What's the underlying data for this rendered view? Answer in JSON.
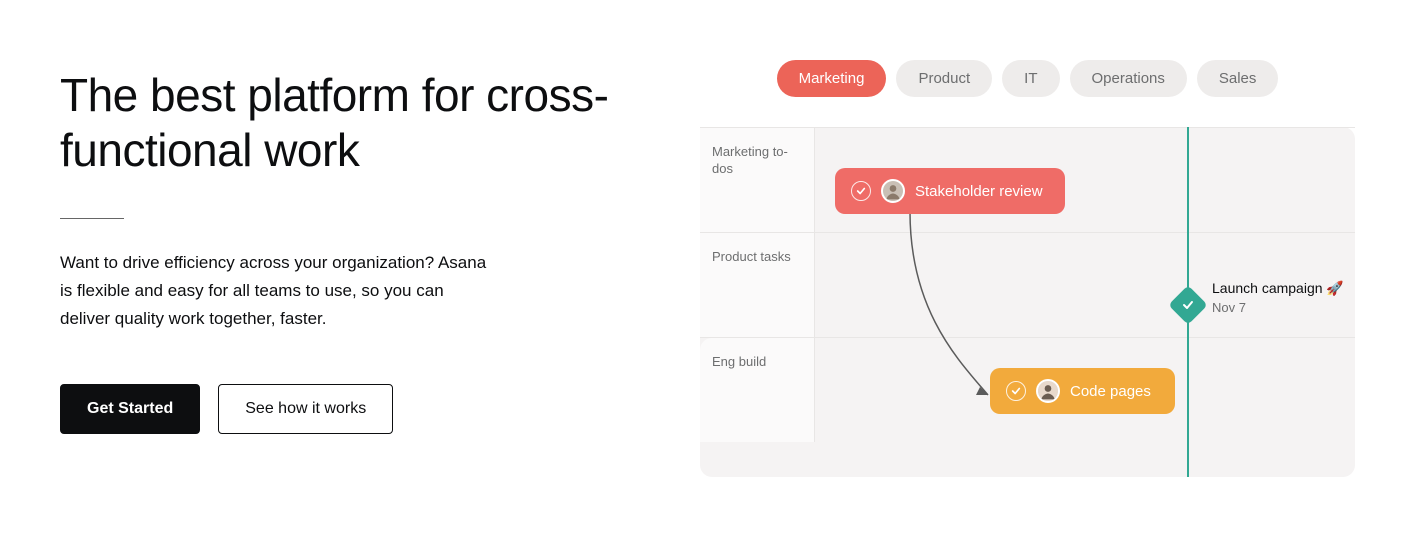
{
  "hero": {
    "headline": "The best platform for cross-functional work",
    "body": "Want to drive efficiency across your organization? Asana is flexible and easy for all teams to use, so you can deliver quality work together, faster.",
    "cta_primary": "Get Started",
    "cta_secondary": "See how it works"
  },
  "tabs": {
    "items": [
      "Marketing",
      "Product",
      "IT",
      "Operations",
      "Sales"
    ],
    "active": 0
  },
  "timeline": {
    "lanes": [
      {
        "label": "Marketing to-dos"
      },
      {
        "label": "Product tasks"
      },
      {
        "label": "Eng build"
      }
    ],
    "tasks": {
      "stakeholder": "Stakeholder review",
      "code": "Code pages"
    },
    "milestone": {
      "title": "Launch campaign 🚀",
      "date": "Nov 7"
    }
  }
}
